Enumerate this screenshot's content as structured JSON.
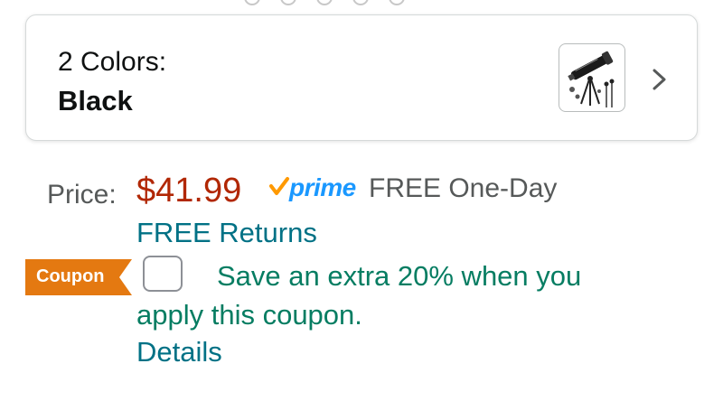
{
  "color_selector": {
    "count_label": "2 Colors:",
    "selected": "Black",
    "swatch_icon": "telescope-product-thumbnail",
    "chevron_icon": "chevron-right-icon"
  },
  "price": {
    "label": "Price:",
    "value": "$41.99",
    "prime_label": "prime",
    "delivery": "FREE One-Day",
    "returns": "FREE Returns"
  },
  "coupon": {
    "badge": "Coupon",
    "checked": false,
    "text": "Save an extra 20% when you apply this coupon.",
    "details_link": "Details"
  },
  "colors": {
    "price": "#b12704",
    "link": "#007185",
    "coupon_text": "#067d62",
    "coupon_badge": "#e47911",
    "prime": "#1a98ff"
  }
}
